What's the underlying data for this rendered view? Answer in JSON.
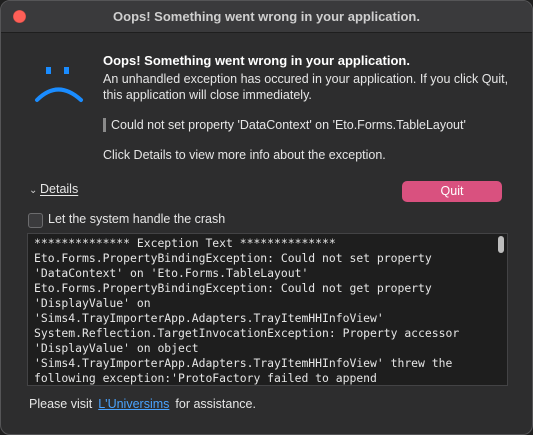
{
  "window": {
    "title": "Oops! Something went wrong in your application."
  },
  "dialog": {
    "heading": "Oops! Something went wrong in your application.",
    "description": "An unhandled exception has occured in your application. If you click Quit, this application will close immediately.",
    "error_message": "Could not set property 'DataContext' on 'Eto.Forms.TableLayout'",
    "details_hint": "Click Details to view more info about the exception.",
    "details_label": "Details",
    "quit_label": "Quit",
    "system_handle_label": "Let the system handle the crash",
    "system_handle_checked": false,
    "exception_text": "************** Exception Text **************\nEto.Forms.PropertyBindingException: Could not set property 'DataContext' on 'Eto.Forms.TableLayout'\nEto.Forms.PropertyBindingException: Could not get property 'DisplayValue' on 'Sims4.TrayImporterApp.Adapters.TrayItemHHInfoView'\nSystem.Reflection.TargetInvocationException: Property accessor 'DisplayValue' on object 'Sims4.TrayImporterApp.Adapters.TrayItemHHInfoView' threw the following exception:'ProtoFactory failed to append"
  },
  "footer": {
    "prefix": "Please visit",
    "link": "L'Universims",
    "suffix": "for assistance."
  },
  "colors": {
    "accent": "#d9517f",
    "link": "#4aa3ff",
    "icon": "#1a8cff",
    "close": "#fe5f57"
  },
  "icons": {
    "window_close": "close-icon",
    "sad_face": "sad-face-icon",
    "details_chevron": "chevron-down-icon"
  }
}
